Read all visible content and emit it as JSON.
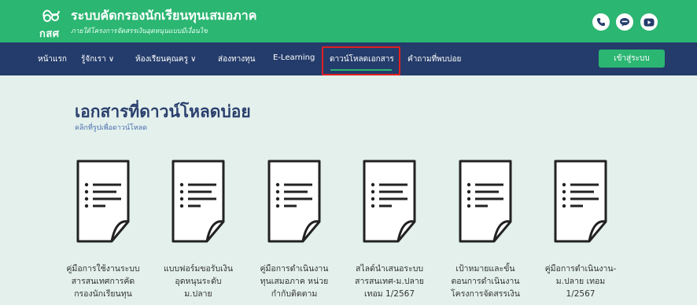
{
  "header": {
    "logo_text": "กสศ",
    "title": "ระบบคัดกรองนักเรียนทุนเสมอภาค",
    "subtitle": "ภายใต้โครงการจัดสรรเงินอุดหนุนแบบมีเงื่อนไข",
    "social": [
      {
        "name": "phone-icon"
      },
      {
        "name": "line-icon"
      },
      {
        "name": "youtube-icon"
      }
    ],
    "colors": {
      "topbar": "#2bb672",
      "navbar": "#243c6b",
      "title": "#2a3f6d"
    }
  },
  "nav": {
    "items": [
      {
        "label": "หน้าแรก"
      },
      {
        "label": "รู้จักเรา ∨"
      },
      {
        "label": "ห้องเรียนคุณครู ∨"
      },
      {
        "label": "ส่องทางทุน"
      },
      {
        "label": "E-Learning"
      },
      {
        "label": "ดาวน์โหลดเอกสาร"
      },
      {
        "label": "คำถามที่พบบ่อย"
      }
    ],
    "active": "ดาวน์โหลดเอกสาร",
    "login_label": "เข้าสู่ระบบ"
  },
  "main": {
    "title": "เอกสารที่ดาวน์โหลดบ่อย",
    "subtitle": "คลิกที่รูปเพื่อดาวน์โหลด",
    "documents": [
      {
        "lines": [
          "คู่มือการใช้งานระบบ",
          "สารสนเทศการคัด",
          "กรองนักเรียนทุน"
        ]
      },
      {
        "lines": [
          "แบบฟอร์มขอรับเงิน",
          "อุดหนุนระดับ",
          "ม.ปลาย"
        ]
      },
      {
        "lines": [
          "คู่มือการดำเนินงาน",
          "ทุนเสมอภาค หน่วย",
          "กำกับติดตาม"
        ]
      },
      {
        "lines": [
          "สไลด์นำเสนอระบบ",
          "สารสนเทศ-ม.ปลาย",
          "เทอม 1/2567"
        ]
      },
      {
        "lines": [
          "เป้าหมายและขั้น",
          "ตอนการดำเนินงาน",
          "โครงการจัดสรรเงิน"
        ]
      },
      {
        "lines": [
          "คู่มือการดำเนินงาน-",
          "ม.ปลาย เทอม",
          "1/2567"
        ]
      }
    ]
  }
}
